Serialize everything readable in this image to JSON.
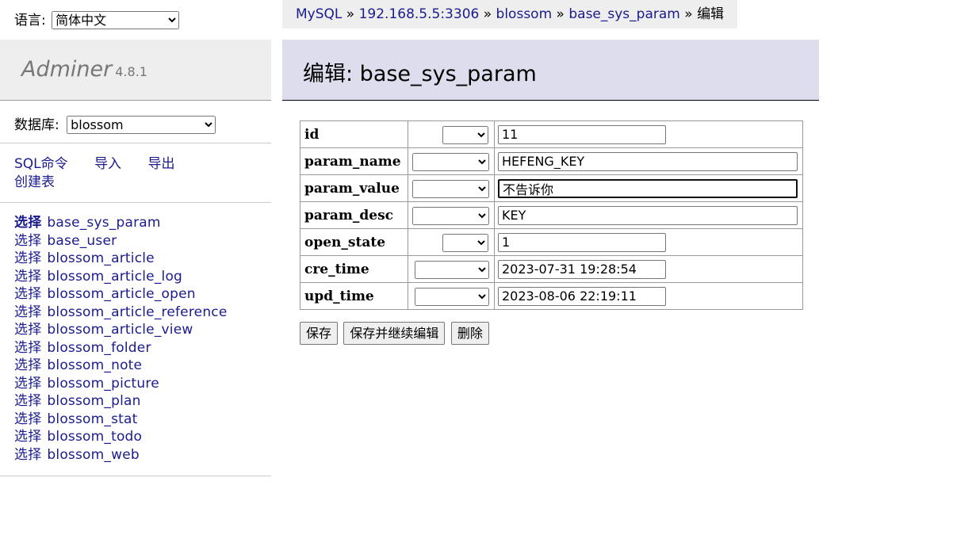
{
  "lang": {
    "label": "语言:",
    "selected": "简体中文"
  },
  "logo": {
    "name": "Adminer",
    "version": "4.8.1"
  },
  "db": {
    "label": "数据库:",
    "selected": "blossom"
  },
  "links": {
    "sql": "SQL命令",
    "import": "导入",
    "export": "导出",
    "create": "创建表"
  },
  "tables": {
    "select_label": "选择",
    "names": [
      "base_sys_param",
      "base_user",
      "blossom_article",
      "blossom_article_log",
      "blossom_article_open",
      "blossom_article_reference",
      "blossom_article_view",
      "blossom_folder",
      "blossom_note",
      "blossom_picture",
      "blossom_plan",
      "blossom_stat",
      "blossom_todo",
      "blossom_web"
    ]
  },
  "breadcrumb": {
    "driver": "MySQL",
    "sep": "»",
    "server": "192.168.5.5:3306",
    "db": "blossom",
    "table": "base_sys_param",
    "current": "编辑"
  },
  "header": {
    "title": "编辑: base_sys_param"
  },
  "fields": [
    {
      "name": "id",
      "value": "11"
    },
    {
      "name": "param_name",
      "value": "HEFENG_KEY"
    },
    {
      "name": "param_value",
      "value": "不告诉你"
    },
    {
      "name": "param_desc",
      "value": "KEY"
    },
    {
      "name": "open_state",
      "value": "1"
    },
    {
      "name": "cre_time",
      "value": "2023-07-31 19:28:54"
    },
    {
      "name": "upd_time",
      "value": "2023-08-06 22:19:11"
    }
  ],
  "buttons": {
    "save": "保存",
    "save_continue": "保存并继续编辑",
    "delete": "删除"
  }
}
